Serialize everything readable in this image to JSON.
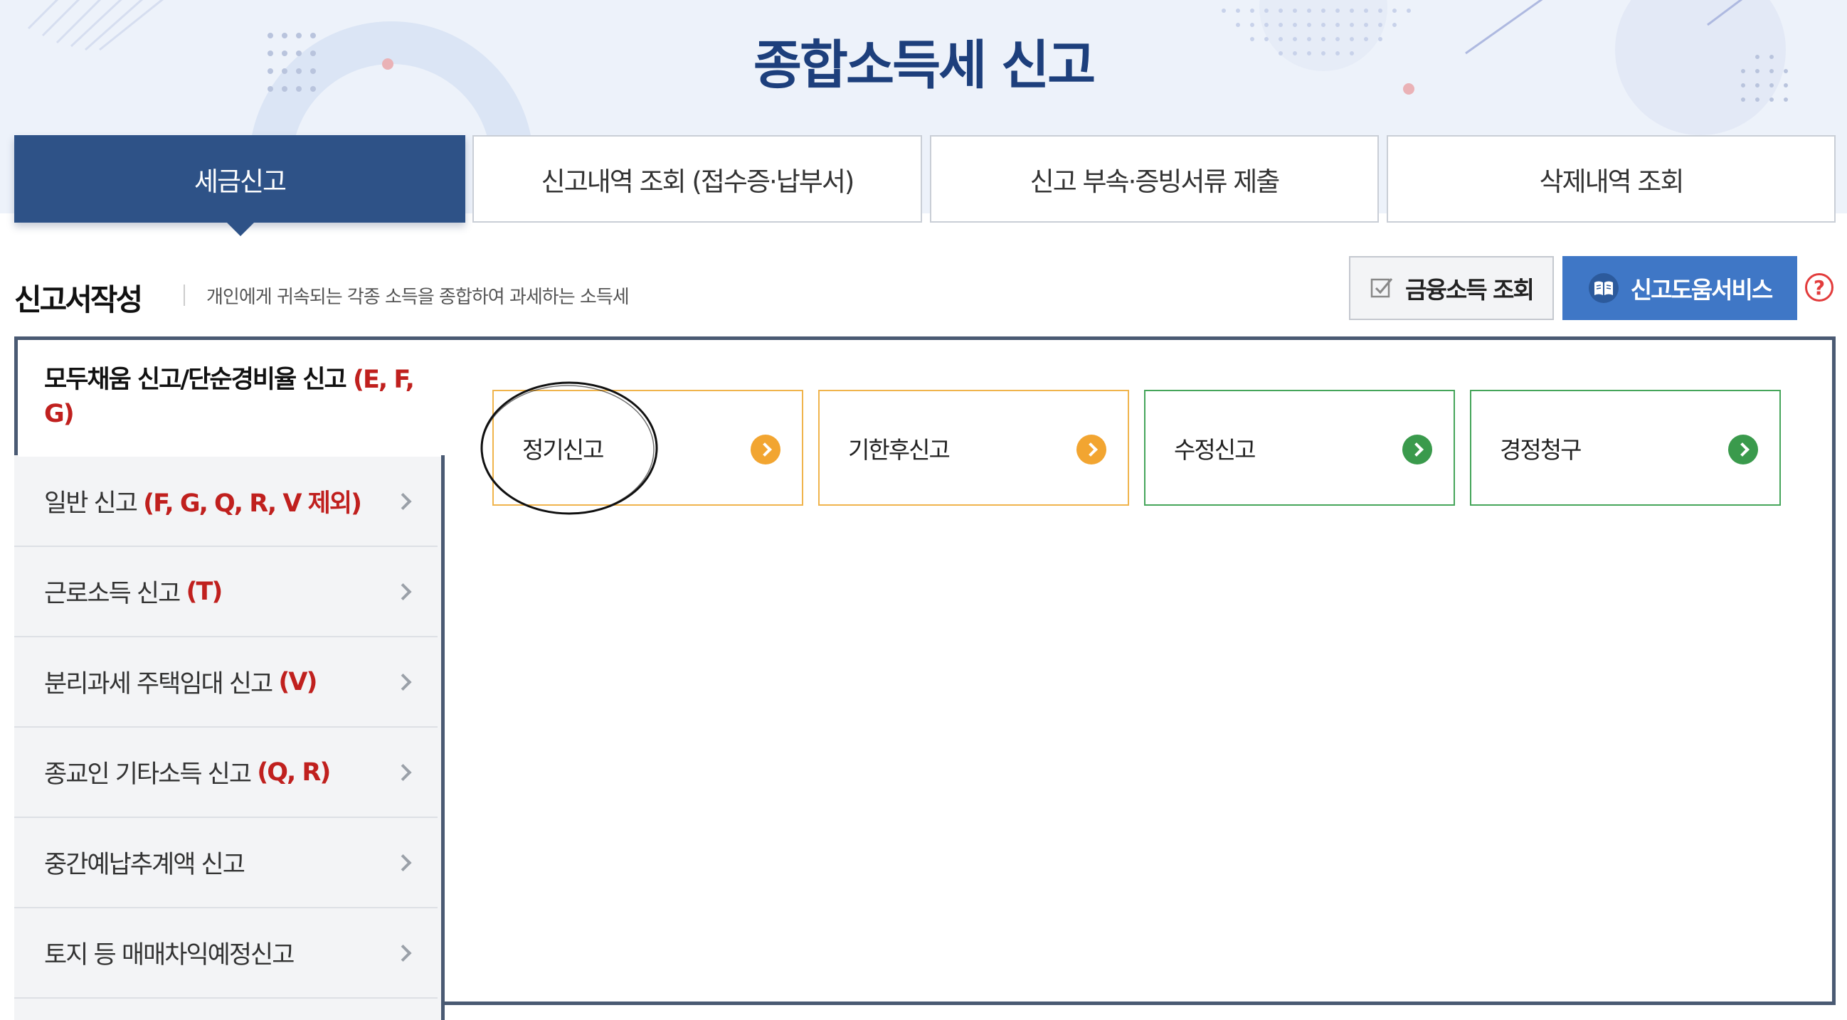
{
  "page": {
    "title": "종합소득세 신고"
  },
  "tabs": [
    {
      "label": "세금신고",
      "active": true
    },
    {
      "label": "신고내역 조회 (접수증·납부서)",
      "active": false
    },
    {
      "label": "신고 부속·증빙서류 제출",
      "active": false
    },
    {
      "label": "삭제내역 조회",
      "active": false
    }
  ],
  "section": {
    "title": "신고서작성",
    "description": "개인에게 귀속되는 각종 소득을 종합하여 과세하는 소득세"
  },
  "header_buttons": {
    "finance_label": "금융소득 조회",
    "finance_icon": "checkbox-icon",
    "help_label": "신고도움서비스",
    "help_icon": "book-icon",
    "question_mark": "?"
  },
  "sidebar": {
    "active": {
      "label": "모두채움 신고/단순경비율 신고",
      "code": "(E, F, G)"
    },
    "items": [
      {
        "label": "일반 신고",
        "code": "(F, G, Q, R, V 제외)"
      },
      {
        "label": "근로소득 신고",
        "code": "(T)"
      },
      {
        "label": "분리과세 주택임대 신고",
        "code": "(V)"
      },
      {
        "label": "종교인 기타소득 신고",
        "code": "(Q, R)"
      },
      {
        "label": "중간예납추계액 신고",
        "code": ""
      },
      {
        "label": "토지 등 매매차익예정신고",
        "code": ""
      }
    ]
  },
  "cards": [
    {
      "label": "정기신고",
      "accent": "#f2a531"
    },
    {
      "label": "기한후신고",
      "accent": "#f2a531"
    },
    {
      "label": "수정신고",
      "accent": "#3a9a4c"
    },
    {
      "label": "경정청구",
      "accent": "#3a9a4c"
    }
  ],
  "colors": {
    "brand_navy": "#2e5287",
    "help_blue": "#3f77c6",
    "code_red": "#c0201e",
    "title_navy": "#1d3f7c"
  }
}
